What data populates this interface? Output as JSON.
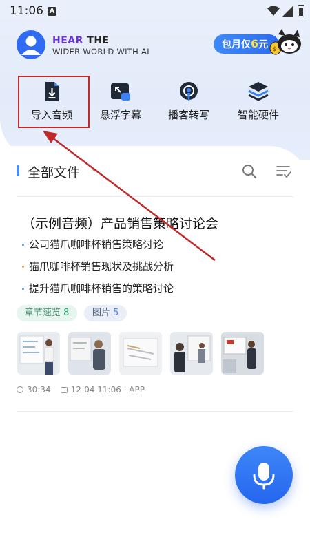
{
  "status_bar": {
    "time": "11:06",
    "notif_icon_letter": "A"
  },
  "header": {
    "brand_line1_a": "HEAR",
    "brand_line1_b": " THE",
    "brand_line2": "WIDER WORLD WITH AI",
    "promo_prefix": "包月仅",
    "promo_price": "6",
    "promo_suffix": "元"
  },
  "quick_actions": [
    {
      "label": "导入音频",
      "icon": "import-audio-icon"
    },
    {
      "label": "悬浮字幕",
      "icon": "floating-subtitle-icon"
    },
    {
      "label": "播客转写",
      "icon": "podcast-transcribe-icon"
    },
    {
      "label": "智能硬件",
      "icon": "smart-hardware-icon"
    }
  ],
  "files_section": {
    "title": "全部文件"
  },
  "file_card": {
    "title": "（示例音频）产品销售策略讨论会",
    "bullets": [
      {
        "text": "公司猫爪咖啡杯销售策略讨论",
        "color": "#4a8cf0"
      },
      {
        "text": "猫爪咖啡杯销售现状及挑战分析",
        "color": "#f0943a"
      },
      {
        "text": "提升猫爪咖啡杯销售的策略讨论",
        "color": "#4a8cf0"
      }
    ],
    "tags": [
      {
        "label": "章节速览",
        "count": "8"
      },
      {
        "label": "图片",
        "count": "5"
      }
    ],
    "duration": "30:34",
    "date_info": "12-04  11:06 · APP"
  },
  "colors": {
    "accent": "#2f6bf3",
    "highlight_box": "#c0282a",
    "brand_purple": "#6a32d8"
  }
}
